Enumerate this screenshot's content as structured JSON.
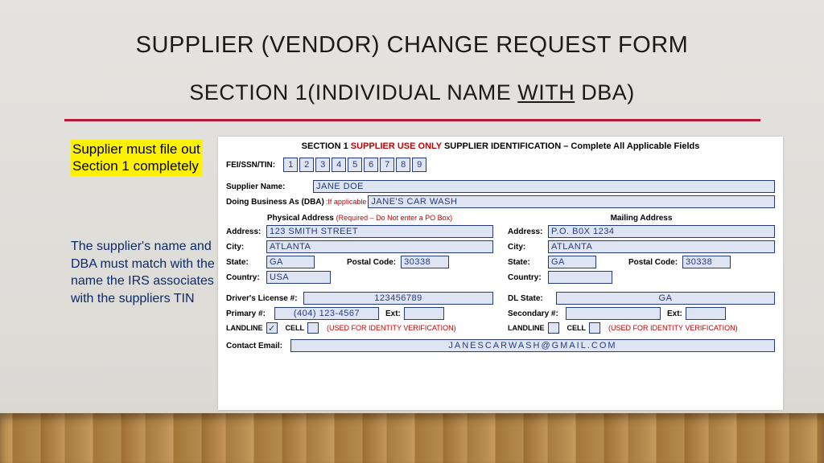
{
  "title": "SUPPLIER (VENDOR) CHANGE REQUEST FORM",
  "subtitle_before": "SECTION 1(INDIVIDUAL NAME ",
  "subtitle_underline": "WITH",
  "subtitle_after": " DBA)",
  "callout": "Supplier must file out\nSection 1 completely",
  "note": "The supplier's name and DBA must match with the name the IRS associates with the suppliers TIN",
  "form": {
    "header_left": "SECTION 1",
    "header_mid_red": "SUPPLIER USE ONLY",
    "header_right": "SUPPLIER IDENTIFICATION – Complete All Applicable Fields",
    "tin_label": "FEI/SSN/TIN:",
    "tin_digits": [
      "1",
      "2",
      "3",
      "4",
      "5",
      "6",
      "7",
      "8",
      "9"
    ],
    "supplier_name_label": "Supplier Name:",
    "supplier_name": "JANE DOE",
    "dba_label": "Doing Business As (DBA)",
    "dba_note": ":If applicable",
    "dba": "JANE'S CAR WASH",
    "phys_hdr": "Physical Address",
    "phys_note": "(Required – Do Not enter a PO Box)",
    "mail_hdr": "Mailing Address",
    "labels": {
      "address": "Address:",
      "city": "City:",
      "state": "State:",
      "postal": "Postal Code:",
      "country": "Country:",
      "dl": "Driver's License #:",
      "dlstate": "DL State:",
      "primary": "Primary #:",
      "secondary": "Secondary #:",
      "ext": "Ext:",
      "landline": "LANDLINE",
      "cell": "CELL",
      "used": "(USED FOR IDENTITY VERIFICATION)",
      "email": "Contact Email:"
    },
    "phys": {
      "address": "123 SMITH STREET",
      "city": "ATLANTA",
      "state": "GA",
      "postal": "30338",
      "country": "USA"
    },
    "mail": {
      "address": "P.O. B0X 1234",
      "city": "ATLANTA",
      "state": "GA",
      "postal": "30338",
      "country": ""
    },
    "dl": "123456789",
    "dlstate": "GA",
    "primary_phone": "(404) 123-4567",
    "primary_ext": "",
    "secondary_phone": "",
    "secondary_ext": "",
    "landline_checked": "✓",
    "cell_checked": "",
    "landline2_checked": "",
    "cell2_checked": "",
    "email": "JANESCARWASH@GMAIL.COM"
  }
}
